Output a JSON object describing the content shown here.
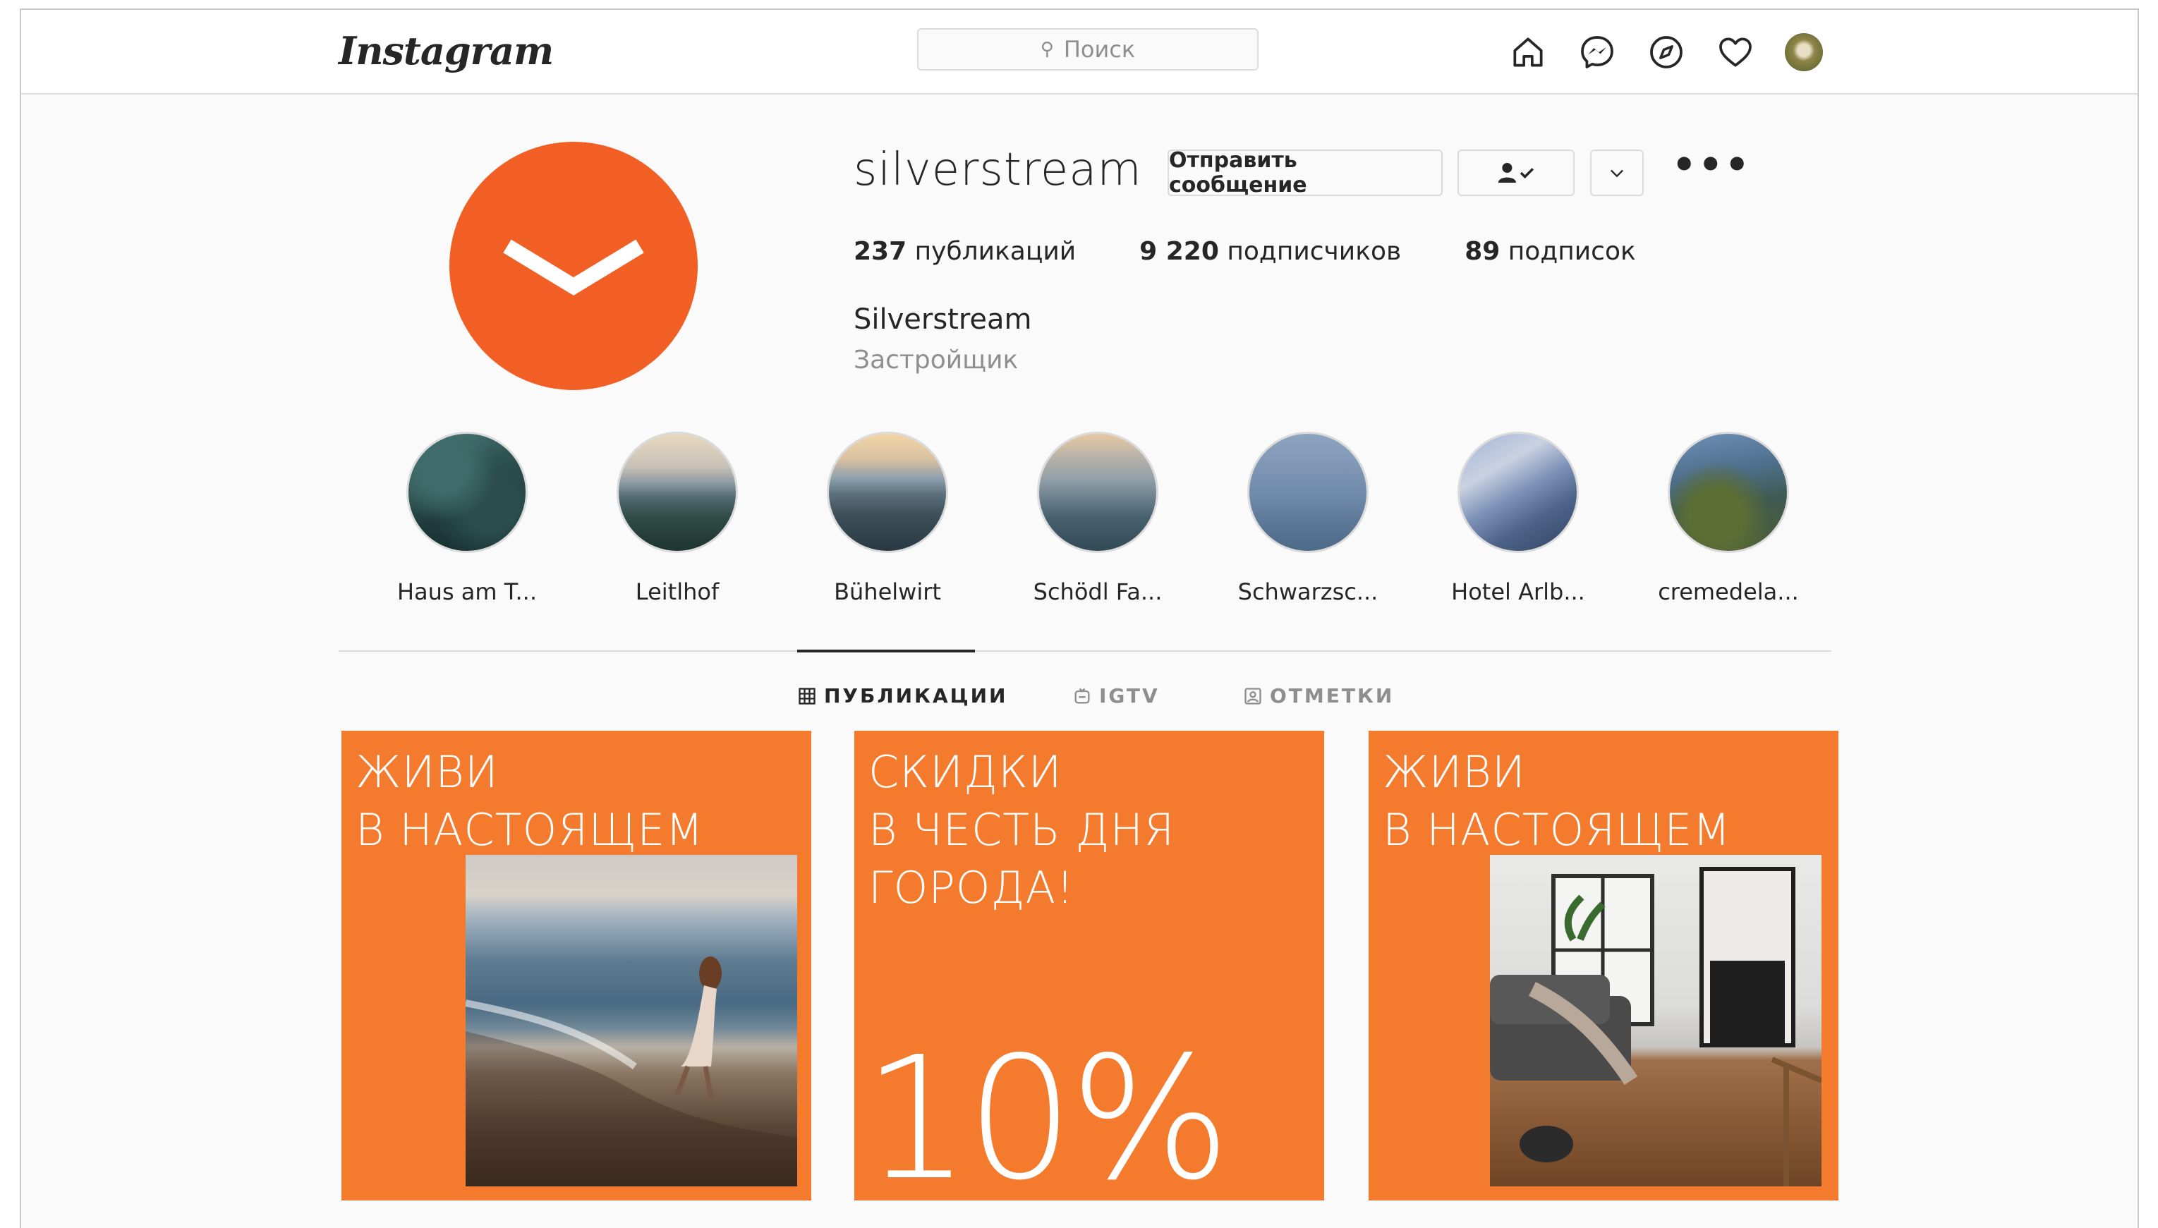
{
  "topbar": {
    "logo": "Instagram",
    "search_placeholder": "Поиск",
    "icons": [
      "home-icon",
      "messenger-icon",
      "explore-icon",
      "heart-icon",
      "avatar"
    ]
  },
  "profile": {
    "username": "silverstream",
    "message_button": "Отправить сообщение",
    "stats": {
      "posts_count": "237",
      "posts_label": "публикаций",
      "followers_count": "9 220",
      "followers_label": "подписчиков",
      "following_count": "89",
      "following_label": "подписок"
    },
    "full_name": "Silverstream",
    "category": "Застройщик",
    "avatar_color": "#f15f24"
  },
  "highlights": [
    {
      "label": "Haus am T..."
    },
    {
      "label": "Leitlhof"
    },
    {
      "label": "Bühelwirt"
    },
    {
      "label": "Schödl Fa..."
    },
    {
      "label": "Schwarzsc..."
    },
    {
      "label": "Hotel Arlb..."
    },
    {
      "label": "cremedela..."
    }
  ],
  "tabs": {
    "posts": "ПУБЛИКАЦИИ",
    "igtv": "IGTV",
    "tagged": "ОТМЕТКИ"
  },
  "posts": [
    {
      "line1": "ЖИВИ",
      "line2": "В НАСТОЯЩЕМ"
    },
    {
      "line1": "СКИДКИ",
      "line2": "В ЧЕСТЬ ДНЯ",
      "line3": "ГОРОДА!",
      "discount": "10%"
    },
    {
      "line1": "ЖИВИ",
      "line2": "В НАСТОЯЩЕМ"
    }
  ],
  "colors": {
    "brand_orange": "#f47a2e",
    "avatar_orange": "#f15f24"
  }
}
